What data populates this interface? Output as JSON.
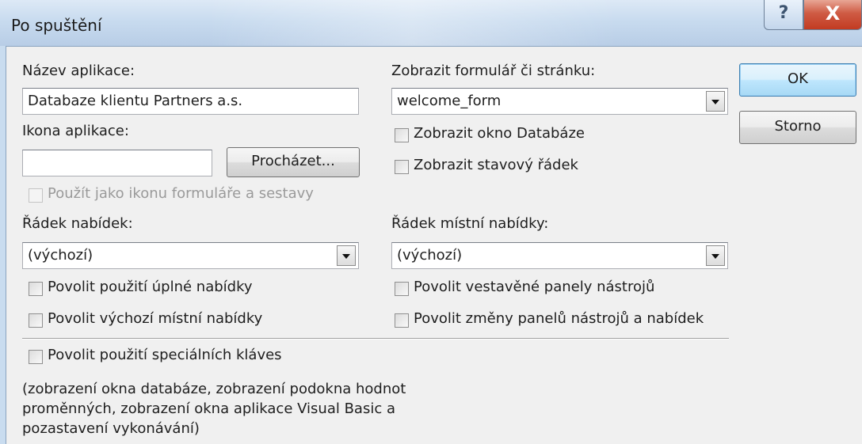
{
  "window": {
    "title": "Po spuštění",
    "help_glyph": "?",
    "close_glyph": "X"
  },
  "app_name": {
    "label": "Název aplikace:",
    "value": "Databaze klientu Partners a.s."
  },
  "app_icon": {
    "label": "Ikona aplikace:",
    "value": "",
    "browse_label": "Procházet...",
    "use_as_form_icon_label": "Použít jako ikonu formuláře a sestavy",
    "use_as_form_icon_checked": false,
    "use_as_form_icon_disabled": true
  },
  "display_form": {
    "label": "Zobrazit formulář či stránku:",
    "value": "welcome_form"
  },
  "options_right": [
    {
      "label": "Zobrazit okno Databáze",
      "checked": false
    },
    {
      "label": "Zobrazit stavový řádek",
      "checked": false
    }
  ],
  "menu_bar": {
    "label": "Řádek nabídek:",
    "value": "(výchozí)"
  },
  "shortcut_menu_bar": {
    "label": "Řádek místní nabídky:",
    "value": "(výchozí)"
  },
  "options_left": [
    {
      "label": "Povolit použití úplné nabídky",
      "checked": false
    },
    {
      "label": "Povolit výchozí místní nabídky",
      "checked": false
    }
  ],
  "options_right2": [
    {
      "label": "Povolit vestavěné panely nástrojů",
      "checked": false
    },
    {
      "label": "Povolit změny panelů nástrojů a nabídek",
      "checked": false
    }
  ],
  "special_keys": {
    "label": "Povolit použití speciálních kláves",
    "checked": false,
    "note": "(zobrazení okna databáze, zobrazení podokna hodnot proměnných, zobrazení okna aplikace Visual Basic a pozastavení vykonávání)"
  },
  "buttons": {
    "ok": "OK",
    "cancel": "Storno"
  }
}
